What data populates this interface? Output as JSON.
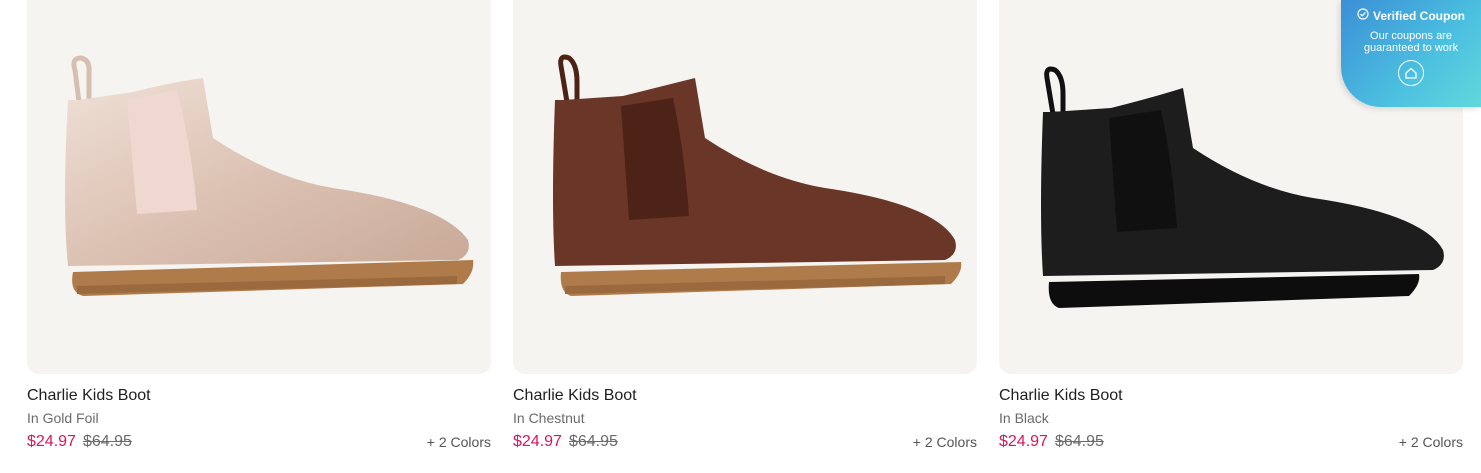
{
  "products": [
    {
      "title": "Charlie Kids Boot",
      "variant": "In Gold Foil",
      "sale_price": "$24.97",
      "original_price": "$64.95",
      "colors": "+ 2 Colors",
      "image": "boot-gold-foil",
      "color_hex": "#e9d3c4"
    },
    {
      "title": "Charlie Kids Boot",
      "variant": "In Chestnut",
      "sale_price": "$24.97",
      "original_price": "$64.95",
      "colors": "+ 2 Colors",
      "image": "boot-chestnut",
      "color_hex": "#6a3628"
    },
    {
      "title": "Charlie Kids Boot",
      "variant": "In Black",
      "sale_price": "$24.97",
      "original_price": "$64.95",
      "colors": "+ 2 Colors",
      "image": "boot-black",
      "color_hex": "#1d1d1d"
    }
  ],
  "coupon_badge": {
    "title": "Verified Coupon",
    "subtitle": "Our coupons are guaranteed to work",
    "icon": "check-circle-icon",
    "logo_icon": "house-logo-icon"
  },
  "colors": {
    "sale": "#d6175c",
    "card_bg": "#f6f4f1"
  }
}
